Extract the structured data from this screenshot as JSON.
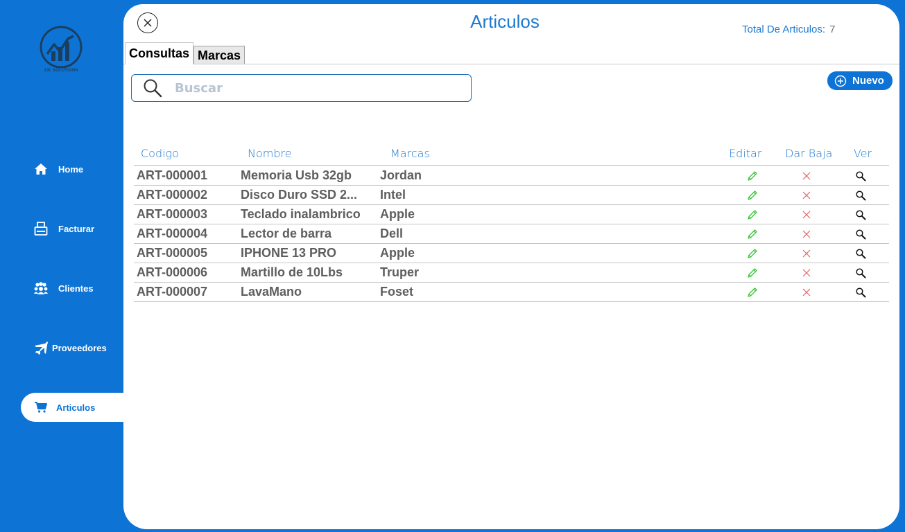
{
  "sidebar": {
    "logo_text": "JJL SOLUTIONS",
    "items": [
      {
        "label": "Home",
        "icon": "home-icon"
      },
      {
        "label": "Facturar",
        "icon": "register-icon"
      },
      {
        "label": "Clientes",
        "icon": "people-icon"
      },
      {
        "label": "Proveedores",
        "icon": "airplane-icon"
      },
      {
        "label": "Articulos",
        "icon": "cart-icon",
        "active": true
      }
    ]
  },
  "header": {
    "title": "Articulos",
    "total_label": "Total De Articulos:",
    "total_value": "7"
  },
  "tabs": [
    {
      "label": "Consultas",
      "active": true
    },
    {
      "label": "Marcas",
      "active": false
    }
  ],
  "search": {
    "placeholder": "Buscar",
    "value": ""
  },
  "new_button": {
    "label": "Nuevo"
  },
  "table": {
    "columns": [
      "Codigo",
      "Nombre",
      "Marcas",
      "Editar",
      "Dar Baja",
      "Ver"
    ],
    "rows": [
      {
        "codigo": "ART-000001",
        "nombre": "Memoria Usb 32gb",
        "marca": "Jordan"
      },
      {
        "codigo": "ART-000002",
        "nombre": "Disco  Duro SSD 2...",
        "marca": "Intel"
      },
      {
        "codigo": "ART-000003",
        "nombre": "Teclado inalambrico",
        "marca": "Apple"
      },
      {
        "codigo": "ART-000004",
        "nombre": "Lector de barra",
        "marca": "Dell"
      },
      {
        "codigo": "ART-000005",
        "nombre": "IPHONE 13 PRO",
        "marca": "Apple"
      },
      {
        "codigo": "ART-000006",
        "nombre": "Martillo de 10Lbs",
        "marca": "Truper"
      },
      {
        "codigo": "ART-000007",
        "nombre": "LavaMano",
        "marca": "Foset"
      }
    ]
  },
  "colors": {
    "brand": "#0d74d6",
    "header_text": "#1c78d0",
    "edit_icon": "#3cc83c",
    "delete_icon": "#e06060",
    "row_text": "#5e5e5e"
  }
}
